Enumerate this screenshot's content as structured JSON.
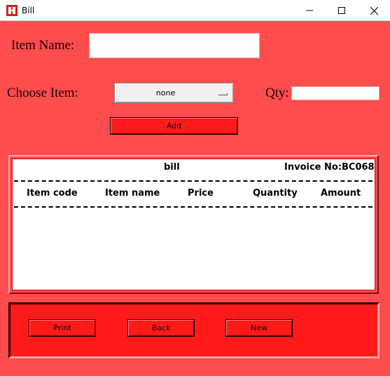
{
  "window": {
    "title": "Bill"
  },
  "form": {
    "item_name_label": "Item Name:",
    "item_name_value": "",
    "choose_item_label": "Choose Item:",
    "choose_item_selected": "none",
    "qty_label": "Qty:",
    "qty_value": "",
    "add_label": "Add"
  },
  "bill": {
    "title": "bill",
    "invoice": "Invoice No:BC068",
    "columns": [
      "Item code",
      "Item name",
      "Price",
      "Quantity",
      "Amount"
    ]
  },
  "actions": {
    "print_label": "Print",
    "back_label": "Back",
    "new_label": "New"
  },
  "colors": {
    "background": "#ff4c4c",
    "button": "#ff1a1a",
    "bill_area": "#ffffff"
  }
}
